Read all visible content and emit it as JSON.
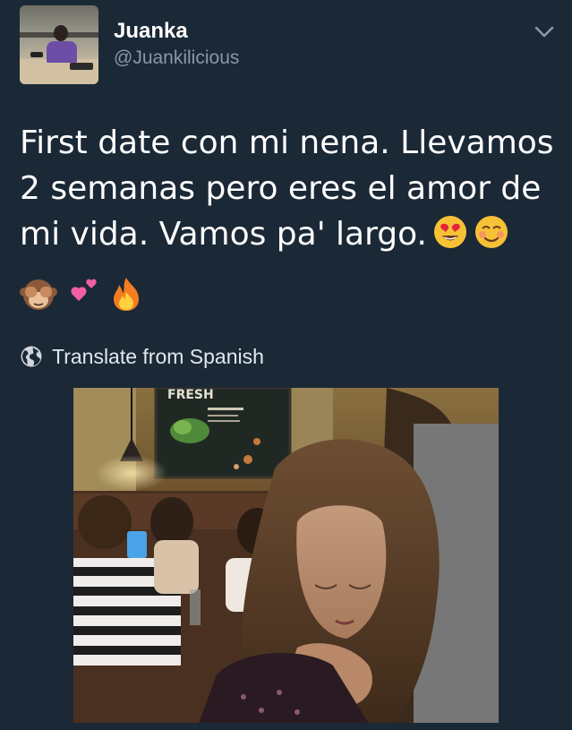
{
  "tweet": {
    "display_name": "Juanka",
    "handle": "@Juankilicious",
    "text_lines": [
      "First date con mi nena. Llevamos",
      "2 semanas pero eres el amor de",
      "mi vida. Vamos pa' largo."
    ],
    "line3_emojis": [
      "heart-eyes-emoji",
      "smiling-blush-emoji"
    ],
    "line4_emojis": [
      "see-no-evil-monkey-emoji",
      "two-hearts-emoji",
      "fire-emoji"
    ],
    "translate_label": "Translate from Spanish"
  },
  "colors": {
    "background": "#1b2836",
    "name": "#ffffff",
    "handle": "#8899a6",
    "text": "#ffffff"
  },
  "icons": {
    "menu": "chevron-down-icon",
    "translate": "globe-icon"
  }
}
